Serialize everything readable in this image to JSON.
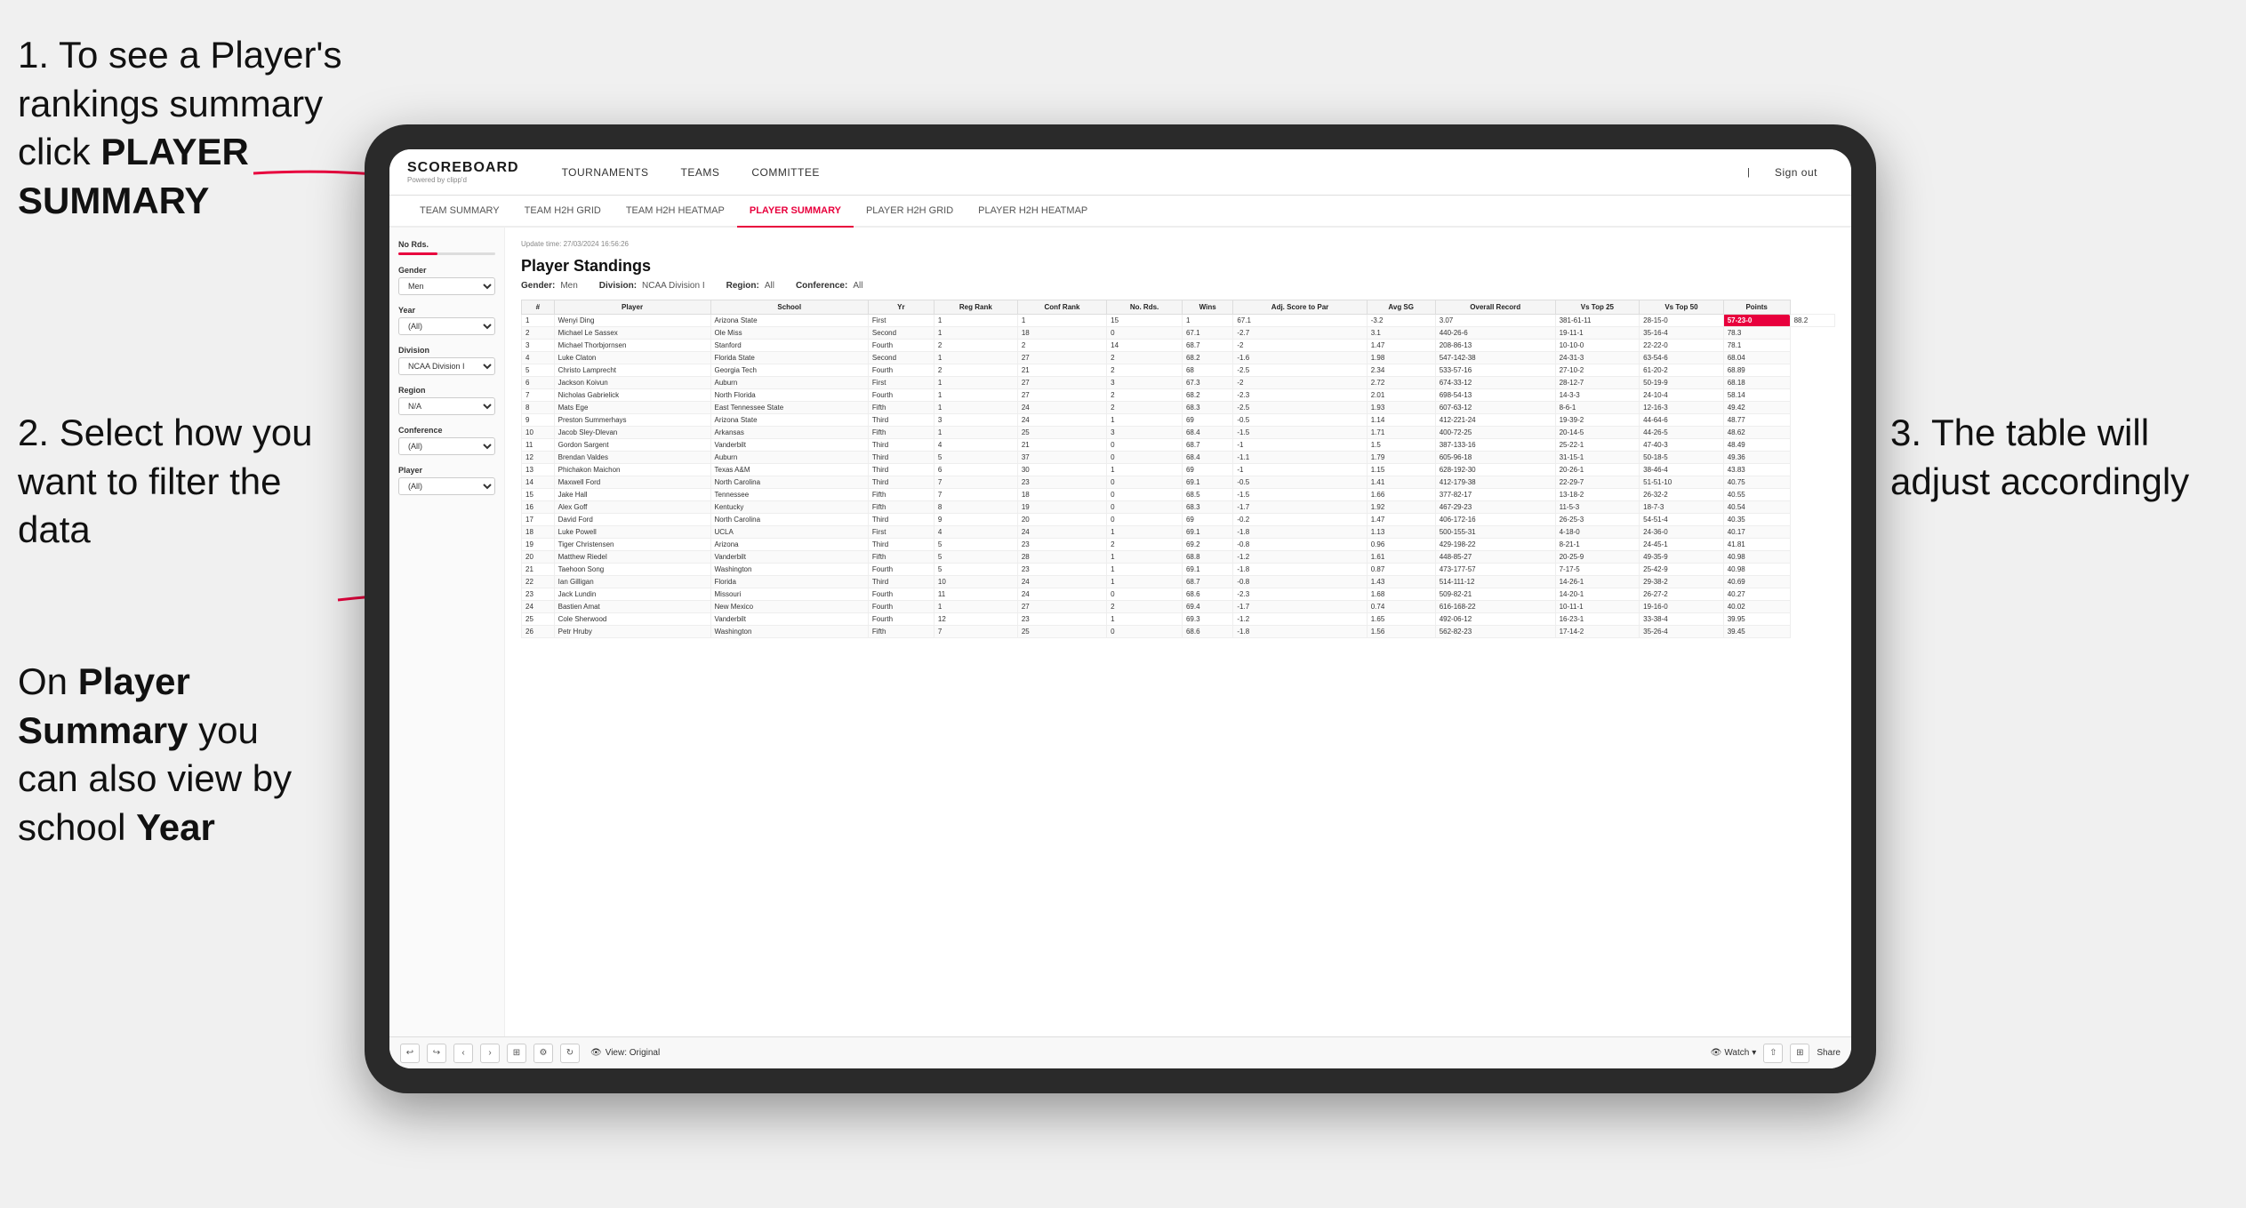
{
  "instructions": {
    "step1": "1. To see a Player's rankings summary click ",
    "step1_bold": "PLAYER SUMMARY",
    "step2_title": "2. Select how you want to",
    "step2_body": "filter the data",
    "step3_title": "3. The table will",
    "step3_body": "adjust accordingly",
    "note_prefix": "On ",
    "note_bold1": "Player Summary",
    "note_middle": " you can also view by school ",
    "note_bold2": "Year"
  },
  "app": {
    "logo": "SCOREBOARD",
    "logo_sub": "Powered by clipp'd",
    "nav": [
      "TOURNAMENTS",
      "TEAMS",
      "COMMITTEE"
    ],
    "header_right": "Sign out",
    "sub_nav": [
      "TEAM SUMMARY",
      "TEAM H2H GRID",
      "TEAM H2H HEATMAP",
      "PLAYER SUMMARY",
      "PLAYER H2H GRID",
      "PLAYER H2H HEATMAP"
    ],
    "active_sub_nav": "PLAYER SUMMARY"
  },
  "sidebar": {
    "no_rds_label": "No Rds.",
    "gender_label": "Gender",
    "gender_value": "Men",
    "year_label": "Year",
    "year_value": "(All)",
    "division_label": "Division",
    "division_value": "NCAA Division I",
    "region_label": "Region",
    "region_value": "N/A",
    "conference_label": "Conference",
    "conference_value": "(All)",
    "player_label": "Player",
    "player_value": "(All)"
  },
  "table": {
    "update_time_label": "Update time:",
    "update_time_value": "27/03/2024 16:56:26",
    "title": "Player Standings",
    "filters": {
      "gender_label": "Gender:",
      "gender_value": "Men",
      "division_label": "Division:",
      "division_value": "NCAA Division I",
      "region_label": "Region:",
      "region_value": "All",
      "conference_label": "Conference:",
      "conference_value": "All"
    },
    "columns": [
      "#",
      "Player",
      "School",
      "Yr",
      "Reg Rank",
      "Conf Rank",
      "No. Rds.",
      "Wins",
      "Adj. Score to Par",
      "Avg SG",
      "Overall Record",
      "Vs Top 25",
      "Vs Top 50",
      "Points"
    ],
    "rows": [
      [
        1,
        "Wenyi Ding",
        "Arizona State",
        "First",
        1,
        1,
        15,
        1,
        67.1,
        -3.2,
        3.07,
        "381-61-11",
        "28-15-0",
        "57-23-0",
        "88.2"
      ],
      [
        2,
        "Michael Le Sassex",
        "Ole Miss",
        "Second",
        1,
        18,
        0,
        67.1,
        -2.7,
        3.1,
        "440-26-6",
        "19-11-1",
        "35-16-4",
        "78.3"
      ],
      [
        3,
        "Michael Thorbjornsen",
        "Stanford",
        "Fourth",
        2,
        2,
        14,
        68.7,
        -2.0,
        1.47,
        "208-86-13",
        "10-10-0",
        "22-22-0",
        "78.1"
      ],
      [
        4,
        "Luke Claton",
        "Florida State",
        "Second",
        1,
        27,
        2,
        68.2,
        -1.6,
        1.98,
        "547-142-38",
        "24-31-3",
        "63-54-6",
        "68.04"
      ],
      [
        5,
        "Christo Lamprecht",
        "Georgia Tech",
        "Fourth",
        2,
        21,
        2,
        68.0,
        -2.5,
        2.34,
        "533-57-16",
        "27-10-2",
        "61-20-2",
        "68.89"
      ],
      [
        6,
        "Jackson Koivun",
        "Auburn",
        "First",
        1,
        27,
        3,
        67.3,
        -2.0,
        2.72,
        "674-33-12",
        "28-12-7",
        "50-19-9",
        "68.18"
      ],
      [
        7,
        "Nicholas Gabrielick",
        "North Florida",
        "Fourth",
        1,
        27,
        2,
        68.2,
        -2.3,
        2.01,
        "698-54-13",
        "14-3-3",
        "24-10-4",
        "58.14"
      ],
      [
        8,
        "Mats Ege",
        "East Tennessee State",
        "Fifth",
        1,
        24,
        2,
        68.3,
        -2.5,
        1.93,
        "607-63-12",
        "8-6-1",
        "12-16-3",
        "49.42"
      ],
      [
        9,
        "Preston Summerhays",
        "Arizona State",
        "Third",
        3,
        24,
        1,
        69.0,
        -0.5,
        1.14,
        "412-221-24",
        "19-39-2",
        "44-64-6",
        "48.77"
      ],
      [
        10,
        "Jacob Sley-Dlevan",
        "Arkansas",
        "Fifth",
        1,
        25,
        3,
        68.4,
        -1.5,
        1.71,
        "400-72-25",
        "20-14-5",
        "44-26-5",
        "48.62"
      ],
      [
        11,
        "Gordon Sargent",
        "Vanderbilt",
        "Third",
        4,
        21,
        0,
        68.7,
        -1.0,
        1.5,
        "387-133-16",
        "25-22-1",
        "47-40-3",
        "48.49"
      ],
      [
        12,
        "Brendan Valdes",
        "Auburn",
        "Third",
        5,
        37,
        0,
        68.4,
        -1.1,
        1.79,
        "605-96-18",
        "31-15-1",
        "50-18-5",
        "49.36"
      ],
      [
        13,
        "Phichakon Maichon",
        "Texas A&M",
        "Third",
        6,
        30,
        1,
        69.0,
        -1.0,
        1.15,
        "628-192-30",
        "20-26-1",
        "38-46-4",
        "43.83"
      ],
      [
        14,
        "Maxwell Ford",
        "North Carolina",
        "Third",
        7,
        23,
        0,
        69.1,
        -0.5,
        1.41,
        "412-179-38",
        "22-29-7",
        "51-51-10",
        "40.75"
      ],
      [
        15,
        "Jake Hall",
        "Tennessee",
        "Fifth",
        7,
        18,
        0,
        68.5,
        -1.5,
        1.66,
        "377-82-17",
        "13-18-2",
        "26-32-2",
        "40.55"
      ],
      [
        16,
        "Alex Goff",
        "Kentucky",
        "Fifth",
        8,
        19,
        0,
        68.3,
        -1.7,
        1.92,
        "467-29-23",
        "11-5-3",
        "18-7-3",
        "40.54"
      ],
      [
        17,
        "David Ford",
        "North Carolina",
        "Third",
        9,
        20,
        0,
        69.0,
        -0.2,
        1.47,
        "406-172-16",
        "26-25-3",
        "54-51-4",
        "40.35"
      ],
      [
        18,
        "Luke Powell",
        "UCLA",
        "First",
        4,
        24,
        1,
        69.1,
        -1.8,
        1.13,
        "500-155-31",
        "4-18-0",
        "24-36-0",
        "40.17"
      ],
      [
        19,
        "Tiger Christensen",
        "Arizona",
        "Third",
        5,
        23,
        2,
        69.2,
        -0.8,
        0.96,
        "429-198-22",
        "8-21-1",
        "24-45-1",
        "41.81"
      ],
      [
        20,
        "Matthew Riedel",
        "Vanderbilt",
        "Fifth",
        5,
        28,
        1,
        68.8,
        -1.2,
        1.61,
        "448-85-27",
        "20-25-9",
        "49-35-9",
        "40.98"
      ],
      [
        21,
        "Taehoon Song",
        "Washington",
        "Fourth",
        5,
        23,
        1,
        69.1,
        -1.8,
        0.87,
        "473-177-57",
        "7-17-5",
        "25-42-9",
        "40.98"
      ],
      [
        22,
        "Ian Gilligan",
        "Florida",
        "Third",
        10,
        24,
        1,
        68.7,
        -0.8,
        1.43,
        "514-111-12",
        "14-26-1",
        "29-38-2",
        "40.69"
      ],
      [
        23,
        "Jack Lundin",
        "Missouri",
        "Fourth",
        11,
        24,
        0,
        68.6,
        -2.3,
        1.68,
        "509-82-21",
        "14-20-1",
        "26-27-2",
        "40.27"
      ],
      [
        24,
        "Bastien Amat",
        "New Mexico",
        "Fourth",
        1,
        27,
        2,
        69.4,
        -1.7,
        0.74,
        "616-168-22",
        "10-11-1",
        "19-16-0",
        "40.02"
      ],
      [
        25,
        "Cole Sherwood",
        "Vanderbilt",
        "Fourth",
        12,
        23,
        1,
        69.3,
        -1.2,
        1.65,
        "492-06-12",
        "16-23-1",
        "33-38-4",
        "39.95"
      ],
      [
        26,
        "Petr Hruby",
        "Washington",
        "Fifth",
        7,
        25,
        0,
        68.6,
        -1.8,
        1.56,
        "562-82-23",
        "17-14-2",
        "35-26-4",
        "39.45"
      ]
    ]
  },
  "toolbar": {
    "view_label": "View: Original",
    "watch_label": "Watch",
    "share_label": "Share"
  }
}
